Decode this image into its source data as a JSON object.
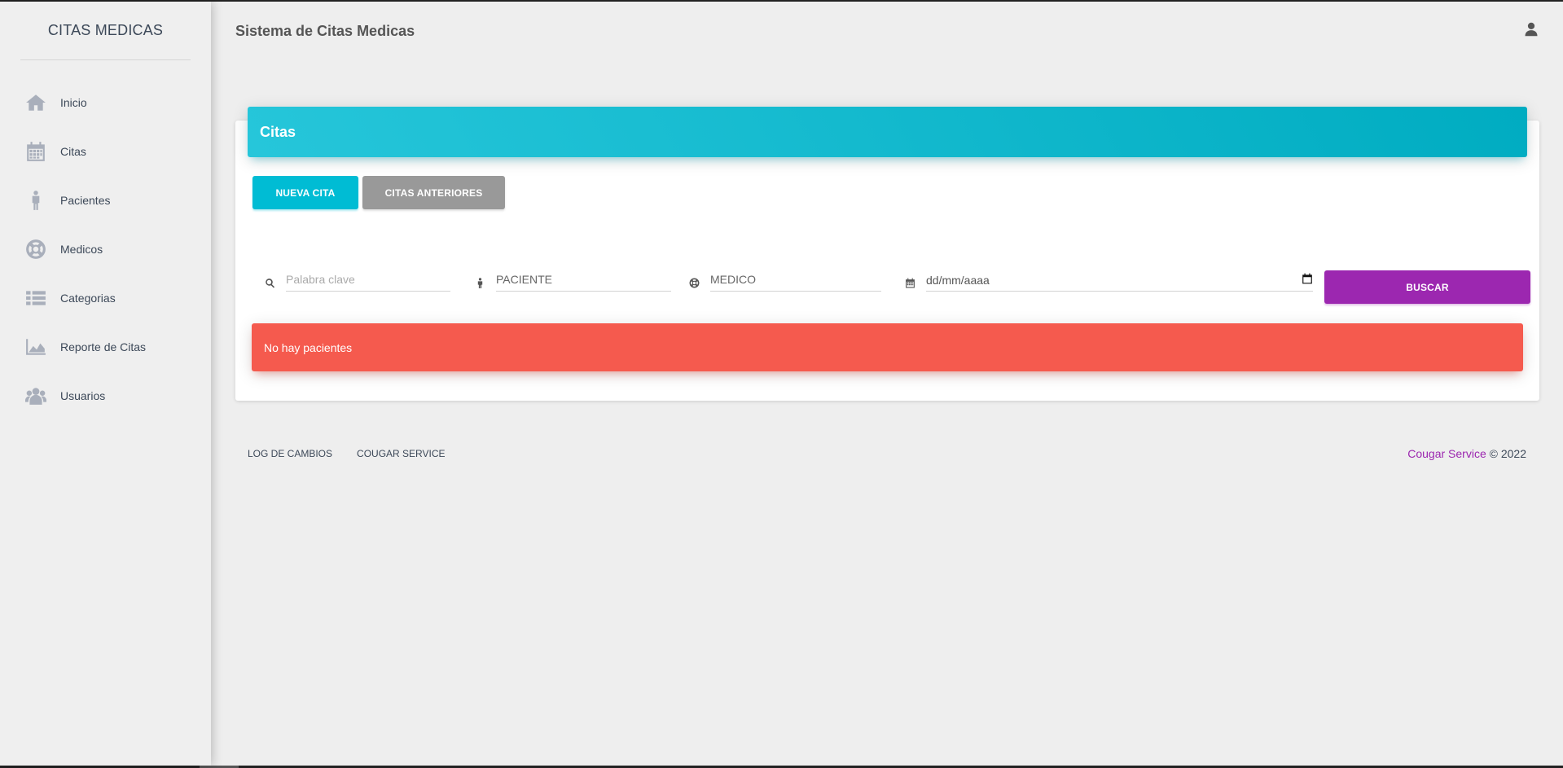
{
  "sidebar": {
    "brand": "CITAS MEDICAS",
    "items": [
      {
        "label": "Inicio",
        "icon": "home-icon"
      },
      {
        "label": "Citas",
        "icon": "calendar-icon"
      },
      {
        "label": "Pacientes",
        "icon": "person-icon"
      },
      {
        "label": "Medicos",
        "icon": "lifebuoy-icon"
      },
      {
        "label": "Categorias",
        "icon": "list-icon"
      },
      {
        "label": "Reporte de Citas",
        "icon": "area-chart-icon"
      },
      {
        "label": "Usuarios",
        "icon": "users-icon"
      }
    ]
  },
  "header": {
    "title": "Sistema de Citas Medicas",
    "user_icon": "user-icon"
  },
  "card": {
    "title": "Citas",
    "new_button": "NUEVA CITA",
    "previous_button": "CITAS ANTERIORES",
    "filters": {
      "keyword_placeholder": "Palabra clave",
      "patient_placeholder": "PACIENTE",
      "doctor_placeholder": "MEDICO",
      "date_placeholder": "dd/mm/aaaa"
    },
    "search_button": "BUSCAR",
    "alert": "No hay pacientes"
  },
  "footer": {
    "links": [
      "LOG DE CAMBIOS",
      "COUGAR SERVICE"
    ],
    "copyright_brand": "Cougar Service",
    "copyright_suffix": "© 2022"
  },
  "colors": {
    "header_cyan": "#00bcd4",
    "button_gray": "#999999",
    "button_purple": "#9c27b0",
    "alert_red": "#f55a4e"
  }
}
